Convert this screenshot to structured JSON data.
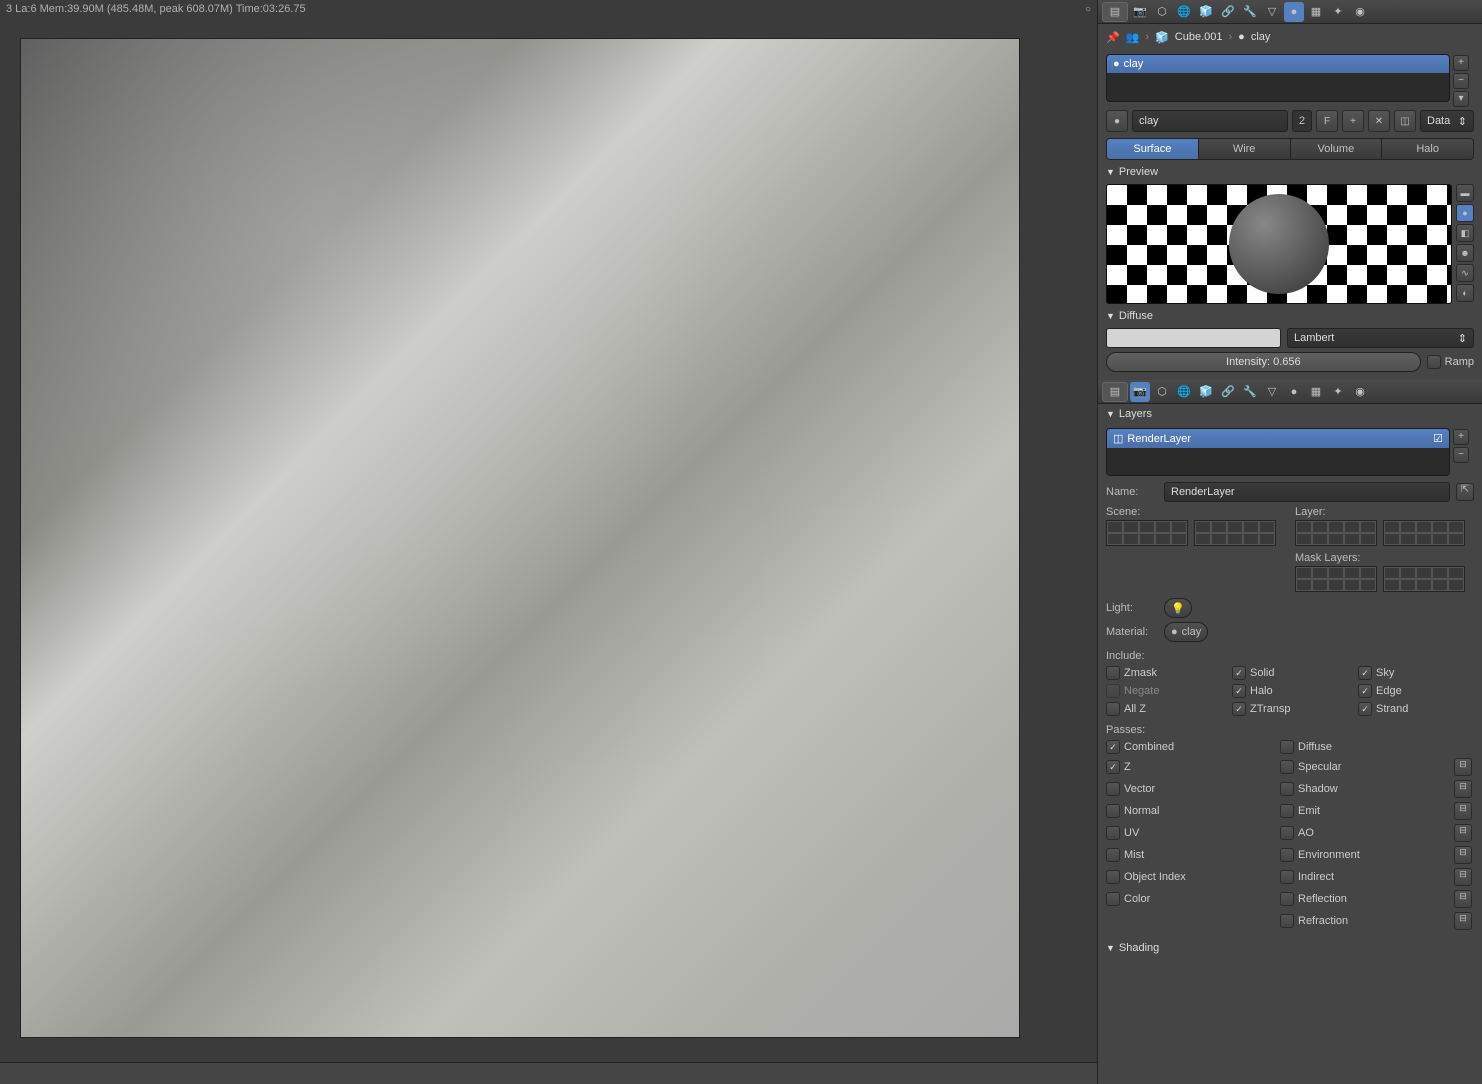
{
  "status": "3 La:6 Mem:39.90M (485.48M, peak 608.07M) Time:03:26.75",
  "breadcrumb": {
    "obj": "Cube.001",
    "mat": "clay"
  },
  "material": {
    "list_selected": "clay",
    "name": "clay",
    "users": "2",
    "link": "Data",
    "tabs": [
      "Surface",
      "Wire",
      "Volume",
      "Halo"
    ]
  },
  "panels": {
    "preview": "Preview",
    "diffuse": "Diffuse",
    "layers": "Layers",
    "shading": "Shading"
  },
  "diffuse": {
    "model": "Lambert",
    "intensity": "Intensity: 0.656",
    "ramp": "Ramp"
  },
  "render_layer": {
    "selected": "RenderLayer",
    "name_label": "Name:",
    "name": "RenderLayer",
    "scene_label": "Scene:",
    "layer_label": "Layer:",
    "light_label": "Light:",
    "mask_label": "Mask Layers:",
    "material_label": "Material:",
    "material_val": "clay"
  },
  "include": {
    "label": "Include:",
    "items": [
      "Zmask",
      "Negate",
      "All Z",
      "Solid",
      "Halo",
      "ZTransp",
      "Sky",
      "Edge",
      "Strand"
    ]
  },
  "passes": {
    "label": "Passes:",
    "left": [
      "Combined",
      "Z",
      "Vector",
      "Normal",
      "UV",
      "Mist",
      "Object Index",
      "Color"
    ],
    "right": [
      "Diffuse",
      "Specular",
      "Shadow",
      "Emit",
      "AO",
      "Environment",
      "Indirect",
      "Reflection",
      "Refraction"
    ]
  },
  "f_label": "F"
}
